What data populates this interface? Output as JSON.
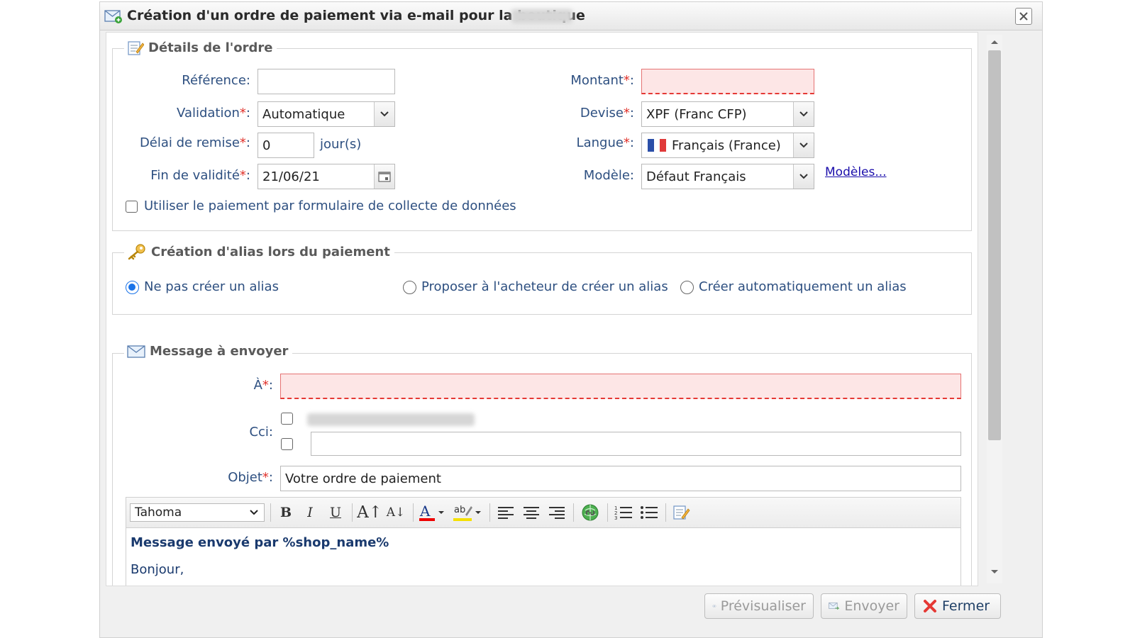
{
  "window": {
    "title": "Création d'un ordre de paiement via e-mail pour la boutique"
  },
  "order_details": {
    "legend": "Détails de l'ordre",
    "reference": {
      "label": "Référence",
      "value": ""
    },
    "amount": {
      "label": "Montant",
      "value": ""
    },
    "validation": {
      "label": "Validation",
      "value": "Automatique"
    },
    "currency": {
      "label": "Devise",
      "value": "XPF (Franc CFP)"
    },
    "delay": {
      "label": "Délai de remise",
      "value": "0",
      "unit": "jour(s)"
    },
    "language": {
      "label": "Langue",
      "value": "Français (France)"
    },
    "expiry": {
      "label": "Fin de validité",
      "value": "21/06/21"
    },
    "template": {
      "label": "Modèle",
      "value": "Défaut Français",
      "link": "Modèles..."
    },
    "form_checkbox": {
      "label": "Utiliser le paiement par formulaire de collecte de données",
      "checked": false
    },
    "required_mark": "*",
    "colon": ":"
  },
  "alias": {
    "legend": "Création d'alias lors du paiement",
    "options": [
      {
        "label": "Ne pas créer un alias",
        "selected": true
      },
      {
        "label": "Proposer à l'acheteur de créer un alias",
        "selected": false
      },
      {
        "label": "Créer automatiquement un alias",
        "selected": false
      }
    ]
  },
  "message": {
    "legend": "Message à envoyer",
    "to_label": "À",
    "cci_label": "Cci",
    "subject_label": "Objet",
    "subject_value": "Votre ordre de paiement",
    "font_select": "Tahoma",
    "body_line1": "Message envoyé par %shop_name%",
    "body_line2": "Bonjour,"
  },
  "footer": {
    "preview_label": "Prévisualiser",
    "send_label": "Envoyer",
    "close_label": "Fermer"
  },
  "colors": {
    "accent": "#1a73e8",
    "error": "#e53935",
    "label": "#2d4f80"
  }
}
